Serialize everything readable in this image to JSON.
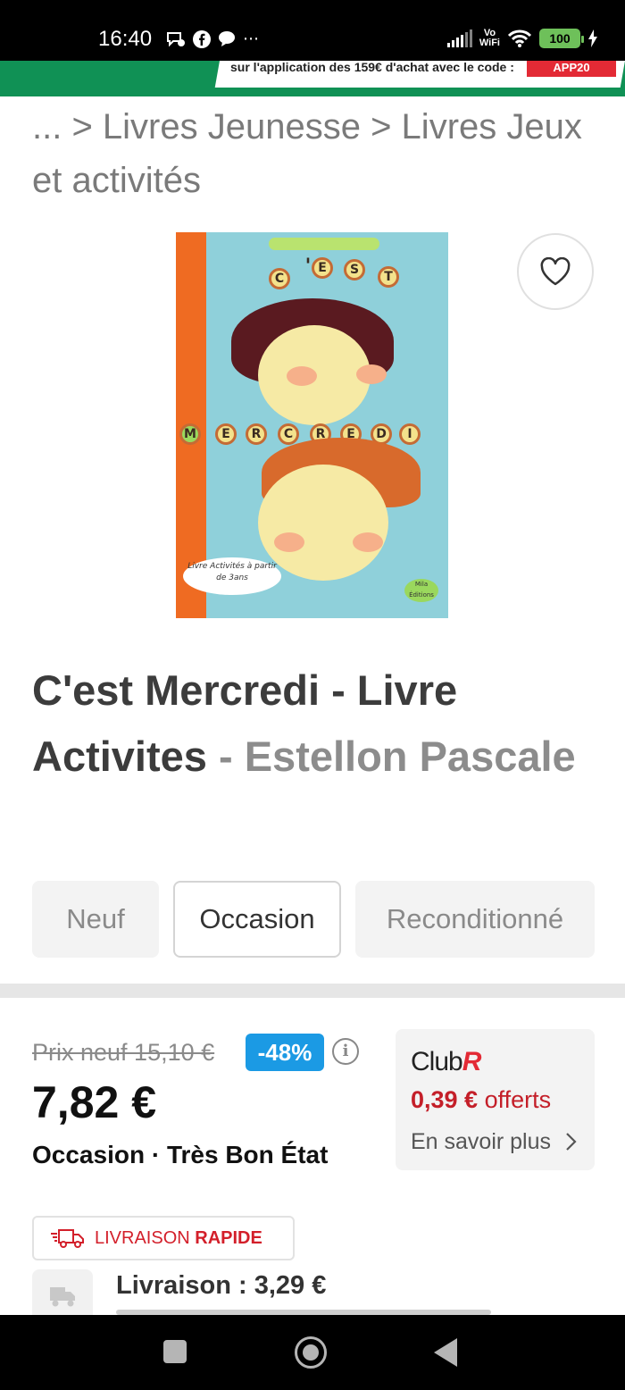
{
  "status_bar": {
    "time": "16:40",
    "left_icons": [
      "message-icon",
      "facebook-icon",
      "chat-icon",
      "more-icon"
    ],
    "more": "⋯",
    "vowifi_top": "Vo",
    "vowifi_bottom": "WiFi",
    "battery": "100"
  },
  "promo": {
    "text": "sur l'application des 159€ d'achat avec le code :",
    "code": "APP20",
    "colors": {
      "banner": "#109155",
      "code": "#e32a35"
    }
  },
  "breadcrumb": {
    "text": "... > Livres Jeunesse  > Livres Jeux et activités"
  },
  "cover": {
    "letters_top": [
      "C",
      "'",
      "E",
      "S",
      "T"
    ],
    "letters_mid": [
      "M",
      "E",
      "R",
      "C",
      "R",
      "E",
      "D",
      "I"
    ],
    "bubble": "Livre Activités à partir de 3ans",
    "logo": "Mila Éditions"
  },
  "product": {
    "title": "C'est Mercredi - Livre Activites",
    "separator": " - ",
    "author": "Estellon Pascale"
  },
  "tabs": [
    {
      "label": "Neuf",
      "selected": false
    },
    {
      "label": "Occasion",
      "selected": true
    },
    {
      "label": "Reconditionné",
      "selected": false
    }
  ],
  "pricing": {
    "old_price": "Prix neuf 15,10 €",
    "discount": "-48%",
    "info": "i",
    "price": "7,82 €",
    "condition": "Occasion · Très Bon État",
    "discount_color": "#1b9ae4"
  },
  "club": {
    "brand_prefix": "Club",
    "brand_suffix": "R",
    "offer_amount": "0,39 €",
    "offer_text": " offerts",
    "more": "En savoir plus"
  },
  "delivery": {
    "badge_prefix": "LIVRAISON ",
    "badge_strong": "RAPIDE",
    "label": "Livraison : 3,29 €"
  }
}
